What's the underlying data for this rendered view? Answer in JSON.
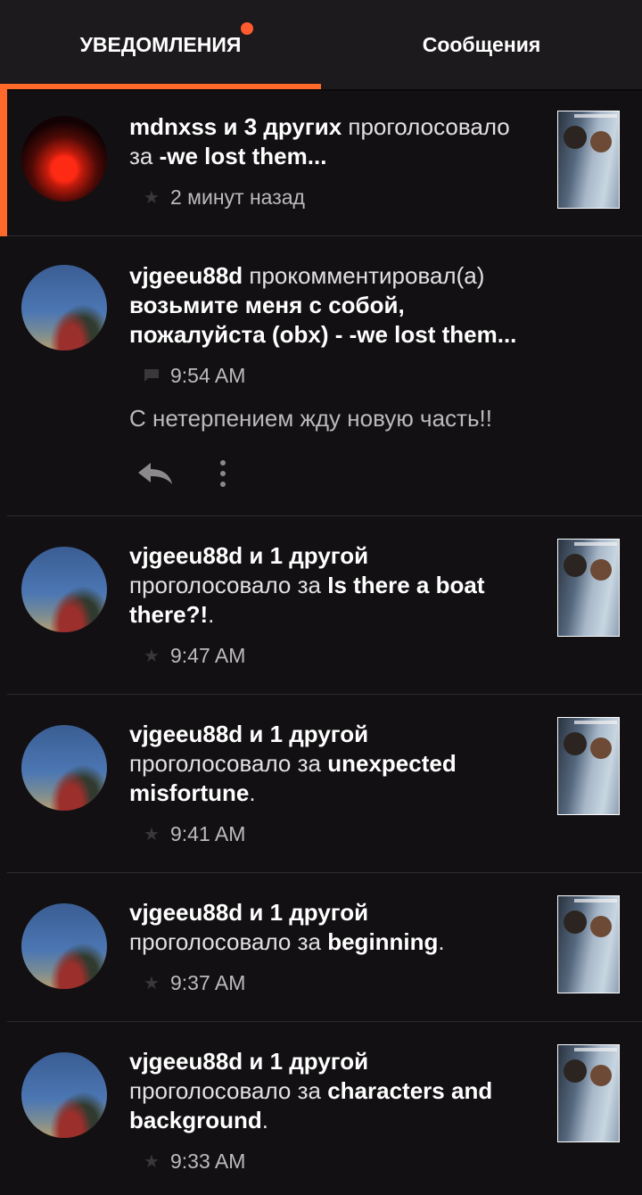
{
  "tabs": {
    "notifications": "УВЕДОМЛЕНИЯ",
    "messages": "Сообщения"
  },
  "colors": {
    "accent": "#ff6a2b",
    "background": "#121012",
    "tab_bar": "#1c1a1c"
  },
  "items": [
    {
      "who": "mdnxss и 3 других",
      "verb": " проголосовало за ",
      "story": "-we lost them...",
      "time": "2 минут назад",
      "icon": "star-icon",
      "unread": true
    },
    {
      "who": "vjgeeu88d",
      "verb": " прокомментировал(а) ",
      "story": "возьмите меня с собой, пожалуйста (obx) - -we lost them...",
      "time": "9:54 AM",
      "icon": "comment-icon",
      "comment": "С нетерпением жду новую часть!!"
    },
    {
      "who": "vjgeeu88d и 1 другой",
      "verb": " проголосовало за ",
      "story": "Is there a boat there?!",
      "tail": ".",
      "time": "9:47 AM",
      "icon": "star-icon"
    },
    {
      "who": "vjgeeu88d и 1 другой",
      "verb": " проголосовало за ",
      "story": "unexpected misfortune",
      "tail": ".",
      "time": "9:41 AM",
      "icon": "star-icon"
    },
    {
      "who": "vjgeeu88d и 1 другой",
      "verb": " проголосовало за ",
      "story": "beginning",
      "tail": ".",
      "time": "9:37 AM",
      "icon": "star-icon"
    },
    {
      "who": "vjgeeu88d и 1 другой",
      "verb": " проголосовало за ",
      "story": "characters and background",
      "tail": ".",
      "time": "9:33 AM",
      "icon": "star-icon"
    }
  ]
}
